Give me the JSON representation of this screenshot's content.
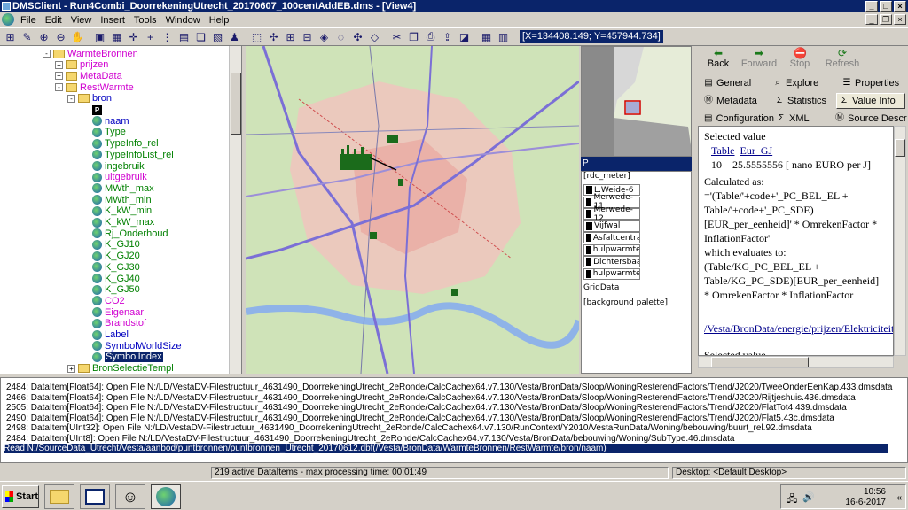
{
  "window": {
    "title": "DMSClient - Run4Combi_DoorrekeningUtrecht_20170607_100centAddEB.dms - [View4]",
    "menus": [
      "File",
      "Edit",
      "View",
      "Insert",
      "Tools",
      "Window",
      "Help"
    ]
  },
  "toolbar": {
    "coords": "[X=134408.149; Y=457944.734]"
  },
  "tree": {
    "items": [
      {
        "label": "WarmteBronnen",
        "color": "mag",
        "pm": "-",
        "icon": "folder"
      },
      {
        "label": "prijzen",
        "color": "mag",
        "pm": "+",
        "icon": "folder"
      },
      {
        "label": "MetaData",
        "color": "mag",
        "pm": "+",
        "icon": "folder"
      },
      {
        "label": "RestWarmte",
        "color": "mag",
        "pm": "-",
        "icon": "folder"
      },
      {
        "label": "bron",
        "color": "blu",
        "pm": "-",
        "icon": "folder"
      },
      {
        "label": "",
        "color": "blk",
        "pm": "",
        "icon": "p"
      },
      {
        "label": "naam",
        "color": "blu",
        "pm": "",
        "icon": "blue"
      },
      {
        "label": "Type",
        "color": "grn",
        "pm": "",
        "icon": "blue"
      },
      {
        "label": "TypeInfo_rel",
        "color": "grn",
        "pm": "",
        "icon": "blue"
      },
      {
        "label": "TypeInfoList_rel",
        "color": "grn",
        "pm": "",
        "icon": "blue"
      },
      {
        "label": "ingebruik",
        "color": "grn",
        "pm": "",
        "icon": "blue"
      },
      {
        "label": "uitgebruik",
        "color": "mag",
        "pm": "",
        "icon": "blue"
      },
      {
        "label": "MWth_max",
        "color": "grn",
        "pm": "",
        "icon": "blue"
      },
      {
        "label": "MWth_min",
        "color": "grn",
        "pm": "",
        "icon": "blue"
      },
      {
        "label": "K_kW_min",
        "color": "grn",
        "pm": "",
        "icon": "blue"
      },
      {
        "label": "K_kW_max",
        "color": "grn",
        "pm": "",
        "icon": "blue"
      },
      {
        "label": "Rj_Onderhoud",
        "color": "grn",
        "pm": "",
        "icon": "blue"
      },
      {
        "label": "K_GJ10",
        "color": "grn",
        "pm": "",
        "icon": "blue"
      },
      {
        "label": "K_GJ20",
        "color": "grn",
        "pm": "",
        "icon": "blue"
      },
      {
        "label": "K_GJ30",
        "color": "grn",
        "pm": "",
        "icon": "blue"
      },
      {
        "label": "K_GJ40",
        "color": "grn",
        "pm": "",
        "icon": "blue"
      },
      {
        "label": "K_GJ50",
        "color": "grn",
        "pm": "",
        "icon": "blue"
      },
      {
        "label": "CO2",
        "color": "mag",
        "pm": "",
        "icon": "blue"
      },
      {
        "label": "Eigenaar",
        "color": "mag",
        "pm": "",
        "icon": "blue"
      },
      {
        "label": "Brandstof",
        "color": "mag",
        "pm": "",
        "icon": "blue"
      },
      {
        "label": "Label",
        "color": "blu",
        "pm": "",
        "icon": "blue"
      },
      {
        "label": "SymbolWorldSize",
        "color": "blu",
        "pm": "",
        "icon": "blue"
      },
      {
        "label": "SymbolIndex",
        "color": "blu",
        "pm": "",
        "icon": "blue",
        "selected": true
      },
      {
        "label": "BronSelectieTempl",
        "color": "grn",
        "pm": "+",
        "icon": "folder"
      }
    ]
  },
  "overview": {
    "header": "P",
    "unit": "[rdc_meter]"
  },
  "legend": {
    "items": [
      "L.Weide-6",
      "Merwede-11",
      "Merwede-12",
      "Vijfwal",
      "Asfaltcentrale",
      "hulpwarmtece",
      "Dichtersbaan",
      "hulpwarmtece"
    ],
    "griddata": "GridData",
    "palette": "[background palette]"
  },
  "nav": {
    "back": "Back",
    "forward": "Forward",
    "stop": "Stop",
    "refresh": "Refresh"
  },
  "tabs": {
    "general": "General",
    "explore": "Explore",
    "properties": "Properties",
    "metadata": "Metadata",
    "statistics": "Statistics",
    "valueinfo": "Value Info",
    "configuration": "Configuration",
    "xml": "XML",
    "sourcedescr": "Source Descr"
  },
  "info": {
    "selected_value": "Selected value",
    "col1": "Table",
    "col2": "Eur_GJ",
    "row_index": "10",
    "row_value": "25.5555556 [ nano EURO per J]",
    "calculated_as": "Calculated as:",
    "expr1": "='(Table/'+code+'_PC_BEL_EL + Table/'+code+'_PC_SDE)",
    "expr2": "[EUR_per_eenheid]' * OmrekenFactor * InflationFactor'",
    "evaluates": "which evaluates to:",
    "eval1": "(Table/KG_PC_BEL_EL + Table/KG_PC_SDE)[EUR_per_eenheid]",
    "eval2": "* OmrekenFactor * InflationFactor",
    "link": "/Vesta/BronData/energie/prijzen/Elektriciteit/",
    "selected_value2": "Selected value"
  },
  "log": {
    "lines": [
      "2484: DataItem[Float64]: Open   File N:/LD/VestaDV-Filestructuur_4631490_DoorrekeningUtrecht_2eRonde/CalcCachex64.v7.130/Vesta/BronData/Sloop/WoningResterendFactors/Trend/J2020/TweeOnderEenKap.433.dmsdata",
      "2466: DataItem[Float64]: Open   File N:/LD/VestaDV-Filestructuur_4631490_DoorrekeningUtrecht_2eRonde/CalcCachex64.v7.130/Vesta/BronData/Sloop/WoningResterendFactors/Trend/J2020/Rijtjeshuis.436.dmsdata",
      "2505: DataItem[Float64]: Open   File N:/LD/VestaDV-Filestructuur_4631490_DoorrekeningUtrecht_2eRonde/CalcCachex64.v7.130/Vesta/BronData/Sloop/WoningResterendFactors/Trend/J2020/FlatTot4.439.dmsdata",
      "2490: DataItem[Float64]: Open   File N:/LD/VestaDV-Filestructuur_4631490_DoorrekeningUtrecht_2eRonde/CalcCachex64.v7.130/Vesta/BronData/Sloop/WoningResterendFactors/Trend/J2020/Flat5.43c.dmsdata",
      "2498: DataItem[UInt32]: Open   File N:/LD/VestaDV-Filestructuur_4631490_DoorrekeningUtrecht_2eRonde/CalcCachex64.v7.130/RunContext/Y2010/VestaRunData/Woning/bebouwing/buurt_rel.92.dmsdata",
      "2484: DataItem[UInt8]: Open    File N:/LD/VestaDV-Filestructuur_4631490_DoorrekeningUtrecht_2eRonde/CalcCachex64.v7.130/Vesta/BronData/bebouwing/Woning/SubType.46.dmsdata",
      "Read N:/SourceData_Utrecht/Vesta/aanbod/puntbronnen/puntbronnen_Utrecht_20170612.dbf(/Vesta/BronData/WarmteBronnen/RestWarmte/bron/naam)"
    ]
  },
  "status": {
    "items": "219 active DataItems - max processing time: 00:01:49",
    "desktop": "Desktop: <Default Desktop>"
  },
  "taskbar": {
    "start": "Start",
    "time": "10:56",
    "date": "16-6-2017"
  }
}
